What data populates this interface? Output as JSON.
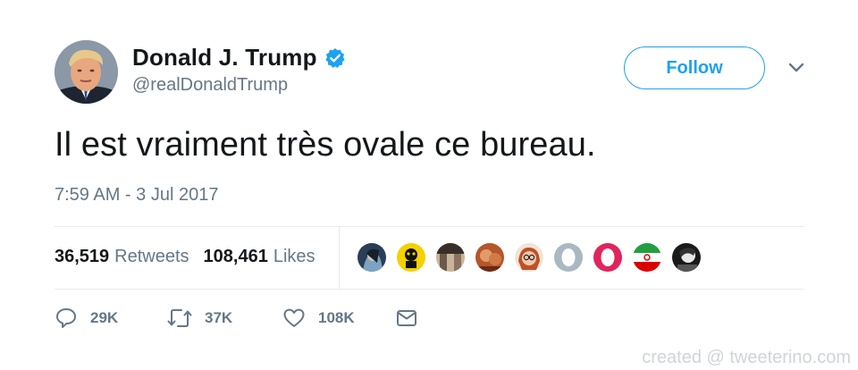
{
  "user": {
    "display_name": "Donald J. Trump",
    "handle": "@realDonaldTrump",
    "verified": true
  },
  "follow_label": "Follow",
  "tweet": {
    "text": "Il est vraiment très ovale ce bureau.",
    "timestamp": "7:59 AM - 3 Jul 2017"
  },
  "stats": {
    "retweets_count": "36,519",
    "retweets_label": "Retweets",
    "likes_count": "108,461",
    "likes_label": "Likes"
  },
  "actions": {
    "reply_count": "29K",
    "retweet_count": "37K",
    "like_count": "108K"
  },
  "watermark": "created @ tweeterino.com",
  "colors": {
    "accent": "#1da1f2",
    "secondary_text": "#657786"
  }
}
